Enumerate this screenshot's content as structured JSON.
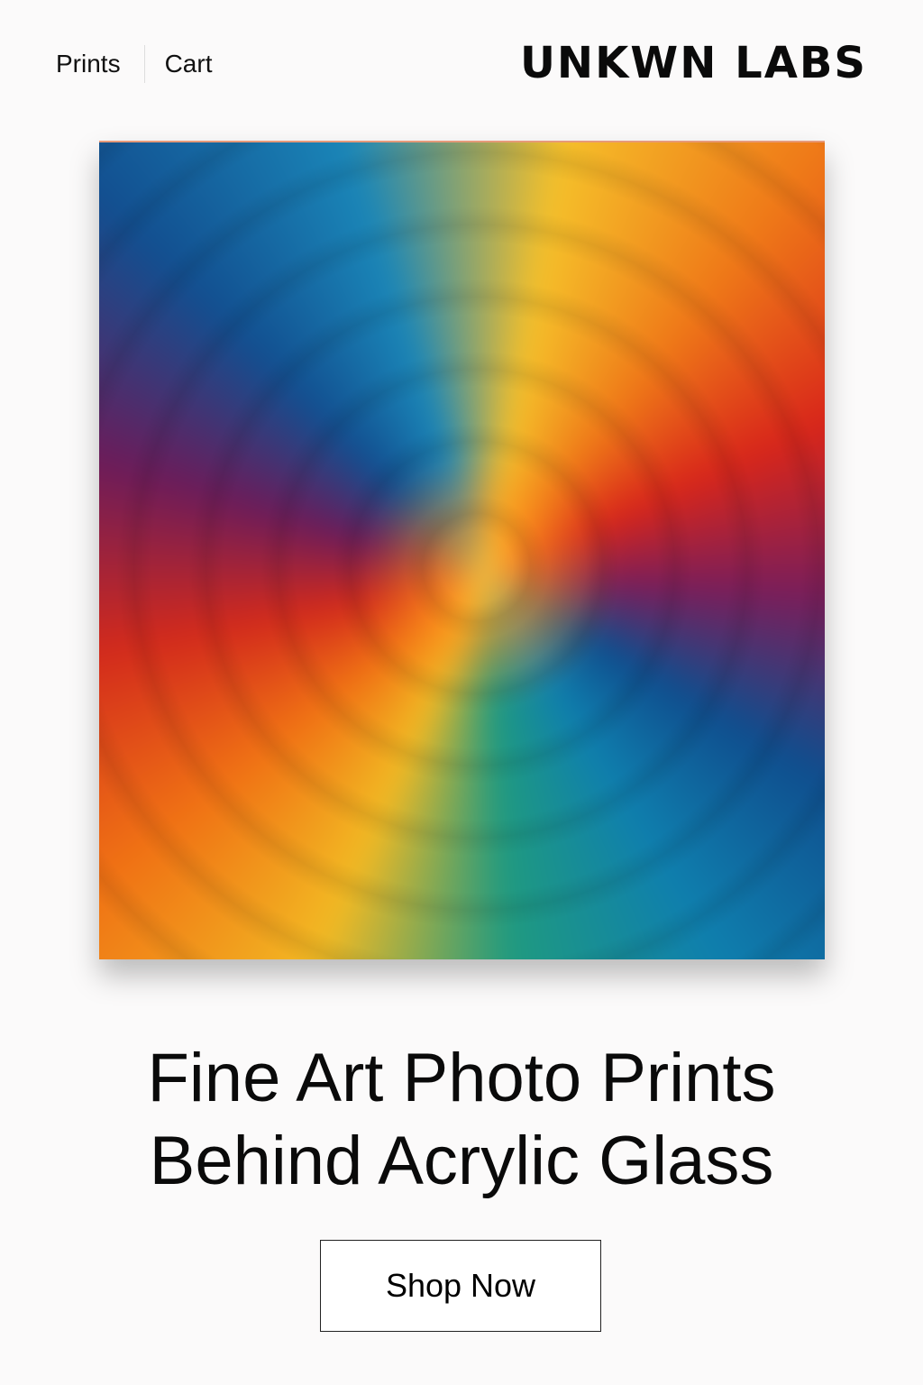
{
  "nav": {
    "items": [
      {
        "label": "Prints"
      },
      {
        "label": "Cart"
      }
    ]
  },
  "brand": {
    "name": "UNKWN LABS"
  },
  "hero": {
    "image_alt": "Colorful rainbow swirl artwork",
    "headline_line1": "Fine Art Photo Prints",
    "headline_line2": "Behind Acrylic Glass",
    "cta_label": "Shop Now"
  }
}
